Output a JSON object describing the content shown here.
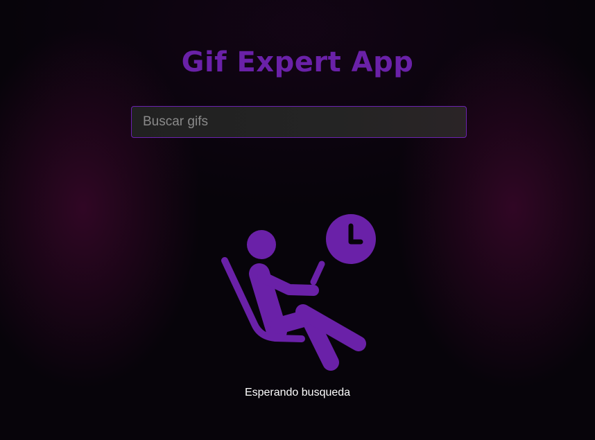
{
  "app": {
    "title": "Gif Expert App"
  },
  "search": {
    "placeholder": "Buscar gifs",
    "value": ""
  },
  "status": {
    "icon": "person-waiting-clock-icon",
    "text": "Esperando busqueda"
  },
  "colors": {
    "accent": "#6a21a8",
    "background": "#07040a",
    "glow": "#52083a",
    "input_background": "#232323",
    "input_border": "#6b22b0",
    "text": "#ffffff"
  }
}
